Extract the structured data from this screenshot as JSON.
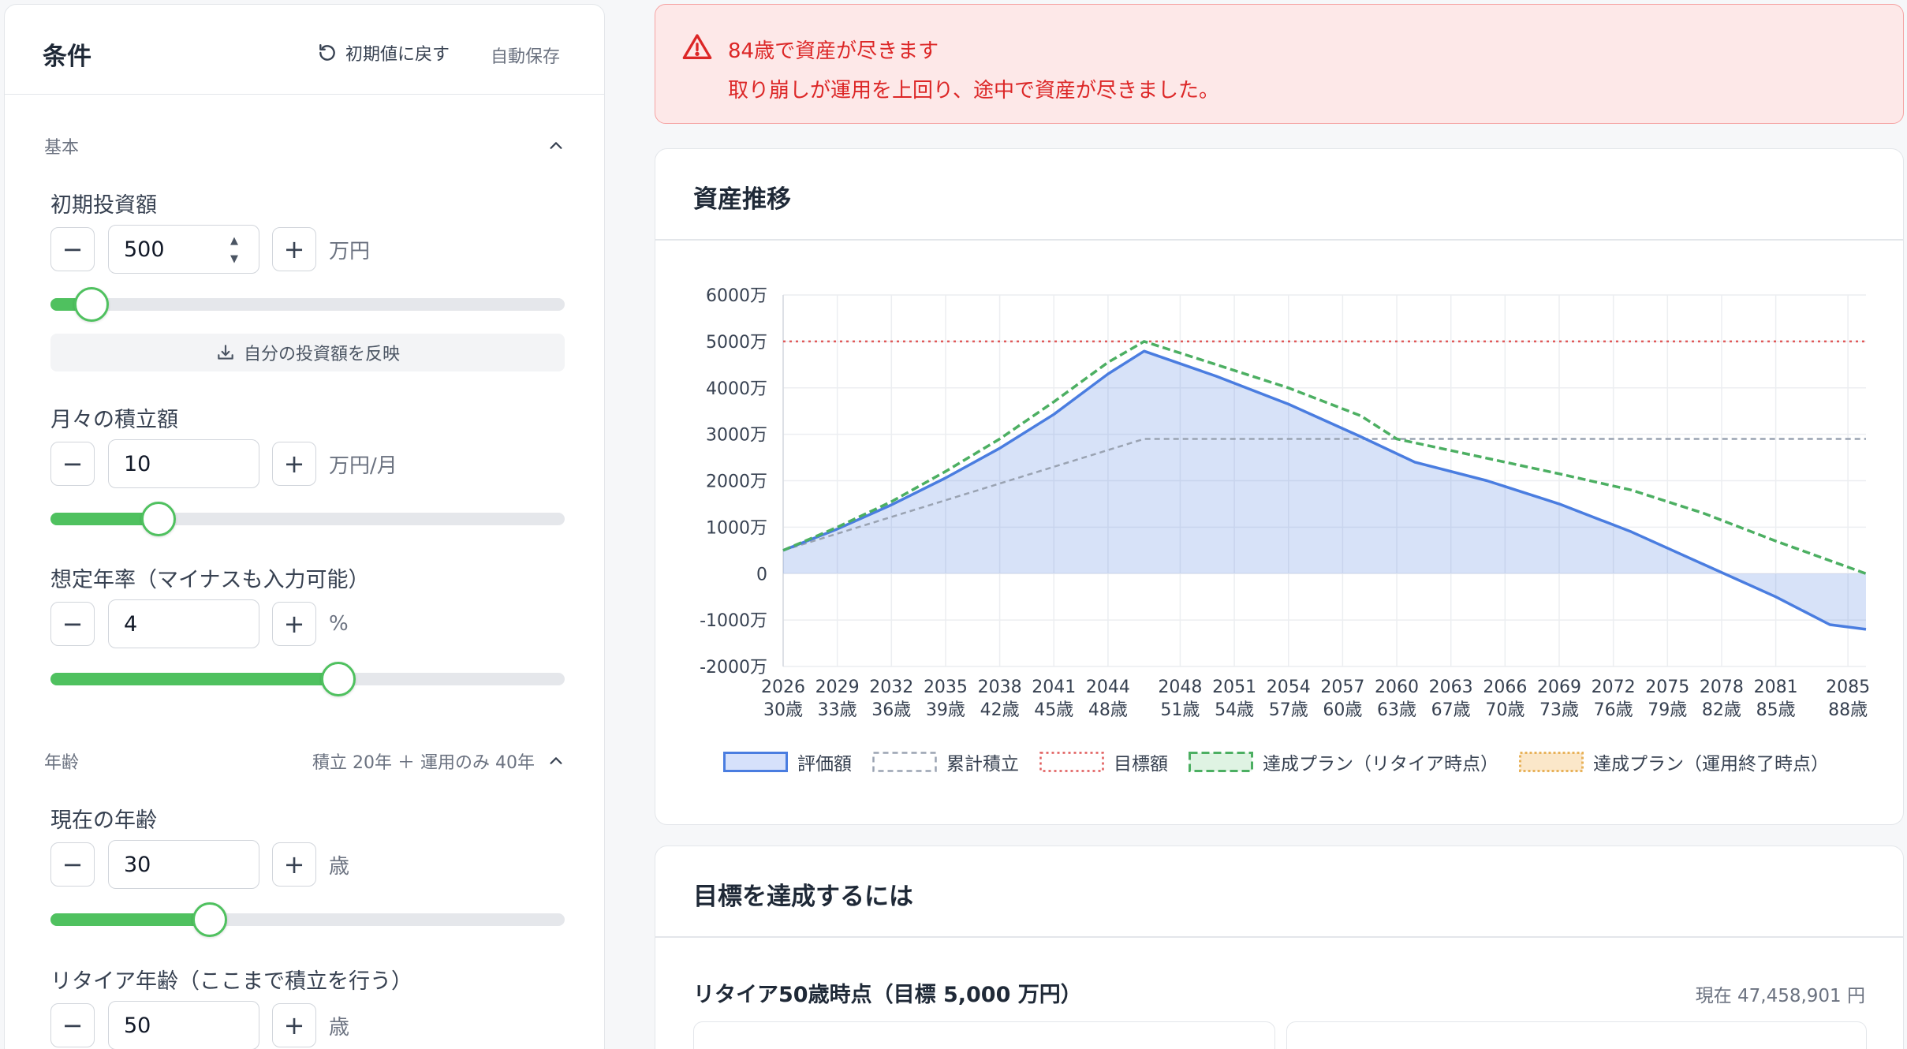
{
  "conditions": {
    "title": "条件",
    "reset_label": "初期値に戻す",
    "autosave_label": "自動保存",
    "basic_section": "基本",
    "initial": {
      "label": "初期投資額",
      "value": "500",
      "unit": "万円",
      "slider_fraction": 0.08
    },
    "reflect_label": "自分の投資額を反映",
    "monthly": {
      "label": "月々の積立額",
      "value": "10",
      "unit": "万円/月",
      "slider_fraction": 0.21
    },
    "rate": {
      "label": "想定年率（マイナスも入力可能）",
      "value": "4",
      "unit": "%",
      "slider_fraction": 0.56
    },
    "age_section": "年齢",
    "age_summary": "積立 20年 ＋ 運用のみ 40年",
    "current_age": {
      "label": "現在の年齢",
      "value": "30",
      "unit": "歳",
      "slider_fraction": 0.31
    },
    "retire_age": {
      "label": "リタイア年齢（ここまで積立を行う）",
      "value": "50",
      "unit": "歳"
    }
  },
  "alert": {
    "title": "84歳で資産が尽きます",
    "body": "取り崩しが運用を上回り、途中で資産が尽きました。",
    "color": "#dc2626"
  },
  "chart_card": {
    "title": "資産推移"
  },
  "chart_data": {
    "type": "line",
    "y_ticks": [
      "6000万",
      "5000万",
      "4000万",
      "3000万",
      "2000万",
      "1000万",
      "0",
      "-1000万",
      "-2000万"
    ],
    "ylim": [
      -2000,
      6000
    ],
    "x_range": [
      2026,
      2086
    ],
    "x_ticks": [
      {
        "year": "2026",
        "age": "30歳"
      },
      {
        "year": "2029",
        "age": "33歳"
      },
      {
        "year": "2032",
        "age": "36歳"
      },
      {
        "year": "2035",
        "age": "39歳"
      },
      {
        "year": "2038",
        "age": "42歳"
      },
      {
        "year": "2041",
        "age": "45歳"
      },
      {
        "year": "2044",
        "age": "48歳"
      },
      {
        "year": "2048",
        "age": "51歳"
      },
      {
        "year": "2051",
        "age": "54歳"
      },
      {
        "year": "2054",
        "age": "57歳"
      },
      {
        "year": "2057",
        "age": "60歳"
      },
      {
        "year": "2060",
        "age": "63歳"
      },
      {
        "year": "2063",
        "age": "67歳"
      },
      {
        "year": "2066",
        "age": "70歳"
      },
      {
        "year": "2069",
        "age": "73歳"
      },
      {
        "year": "2072",
        "age": "76歳"
      },
      {
        "year": "2075",
        "age": "79歳"
      },
      {
        "year": "2078",
        "age": "82歳"
      },
      {
        "year": "2081",
        "age": "85歳"
      },
      {
        "year": "2085",
        "age": "88歳"
      }
    ],
    "series": [
      {
        "name": "評価額",
        "color": "#4a7de0",
        "x": [
          2026,
          2029,
          2032,
          2035,
          2038,
          2041,
          2044,
          2046,
          2050,
          2054,
          2058,
          2061,
          2065,
          2069,
          2073,
          2077,
          2081,
          2084,
          2086
        ],
        "values": [
          500,
          960,
          1480,
          2060,
          2700,
          3430,
          4300,
          4790,
          4250,
          3650,
          2950,
          2400,
          2000,
          1500,
          900,
          200,
          -500,
          -1100,
          -1200
        ]
      },
      {
        "name": "累計積立",
        "color": "#9aa3b2",
        "x": [
          2026,
          2046,
          2086
        ],
        "values": [
          500,
          2900,
          2900
        ]
      },
      {
        "name": "目標額",
        "color": "#e05a5a",
        "x": [
          2026,
          2086
        ],
        "values": [
          5000,
          5000
        ]
      },
      {
        "name": "達成プラン（リタイア時点）",
        "color": "#4caf62",
        "x": [
          2026,
          2029,
          2032,
          2035,
          2038,
          2041,
          2044,
          2046,
          2050,
          2054,
          2058,
          2060,
          2063,
          2066,
          2069,
          2073,
          2077,
          2081,
          2086
        ],
        "values": [
          500,
          1000,
          1550,
          2200,
          2900,
          3700,
          4550,
          5000,
          4500,
          4000,
          3400,
          2900,
          2650,
          2400,
          2150,
          1800,
          1300,
          700,
          0
        ]
      },
      {
        "name": "達成プラン（運用終了時点）",
        "color": "#e8b25a",
        "x": [],
        "values": []
      }
    ]
  },
  "goal_card": {
    "title": "目標を達成するには",
    "subtitle": "リタイア50歳時点（目標 5,000 万円）",
    "current": "現在 47,458,901 円"
  }
}
